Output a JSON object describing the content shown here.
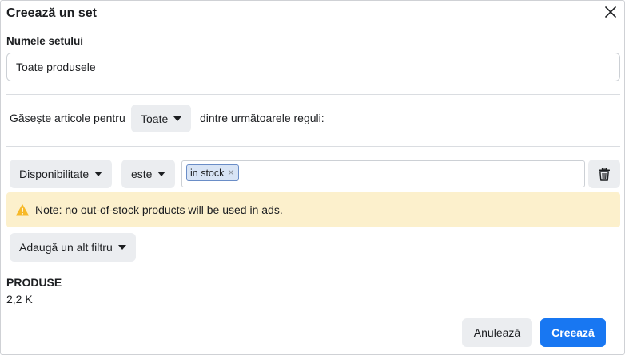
{
  "dialog": {
    "title": "Creează un set",
    "close_icon": "close-icon"
  },
  "set_name": {
    "label": "Numele setului",
    "value": "Toate produsele"
  },
  "rules": {
    "prefix": "Găsește articole pentru",
    "match_mode": "Toate",
    "suffix": "dintre următoarele reguli:"
  },
  "filter": {
    "field": "Disponibilitate",
    "operator": "este",
    "tags": [
      "in stock"
    ],
    "remove_tag_icon": "close-icon",
    "delete_icon": "trash-icon"
  },
  "note": {
    "icon": "warning-icon",
    "text": "Note: no out-of-stock products will be used in ads.",
    "background": "#fcf0cc",
    "icon_color": "#f7b928"
  },
  "add_filter": {
    "label": "Adaugă un alt filtru"
  },
  "products": {
    "label": "PRODUSE",
    "count": "2,2 K"
  },
  "footer": {
    "cancel_label": "Anulează",
    "create_label": "Creează",
    "create_color": "#1877f2"
  }
}
